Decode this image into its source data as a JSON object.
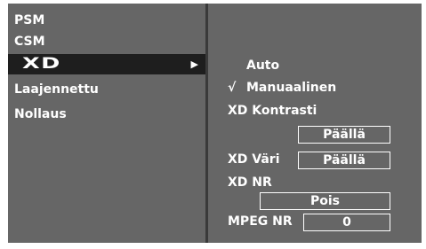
{
  "left_menu": {
    "items": [
      {
        "label": "PSM"
      },
      {
        "label": "CSM"
      },
      {
        "label": "XD",
        "selected": true,
        "arrow": "▶"
      },
      {
        "label": "Laajennettu"
      },
      {
        "label": "Nollaus"
      }
    ]
  },
  "right_panel": {
    "auto_label": "Auto",
    "manual_label": "Manuaalinen",
    "check_mark": "√",
    "xd_contrast_label": "XD Kontrasti",
    "xd_contrast_value": "Päällä",
    "xd_color_label": "XD Väri",
    "xd_color_value": "Päällä",
    "xd_nr_label": "XD NR",
    "xd_nr_value": "Pois",
    "mpeg_nr_label": "MPEG NR",
    "mpeg_nr_value": "0"
  },
  "colors": {
    "panel_bg": "#666666",
    "selected_bg": "#1e1e1e",
    "text": "#ffffff",
    "divider": "#3a3a3a"
  }
}
